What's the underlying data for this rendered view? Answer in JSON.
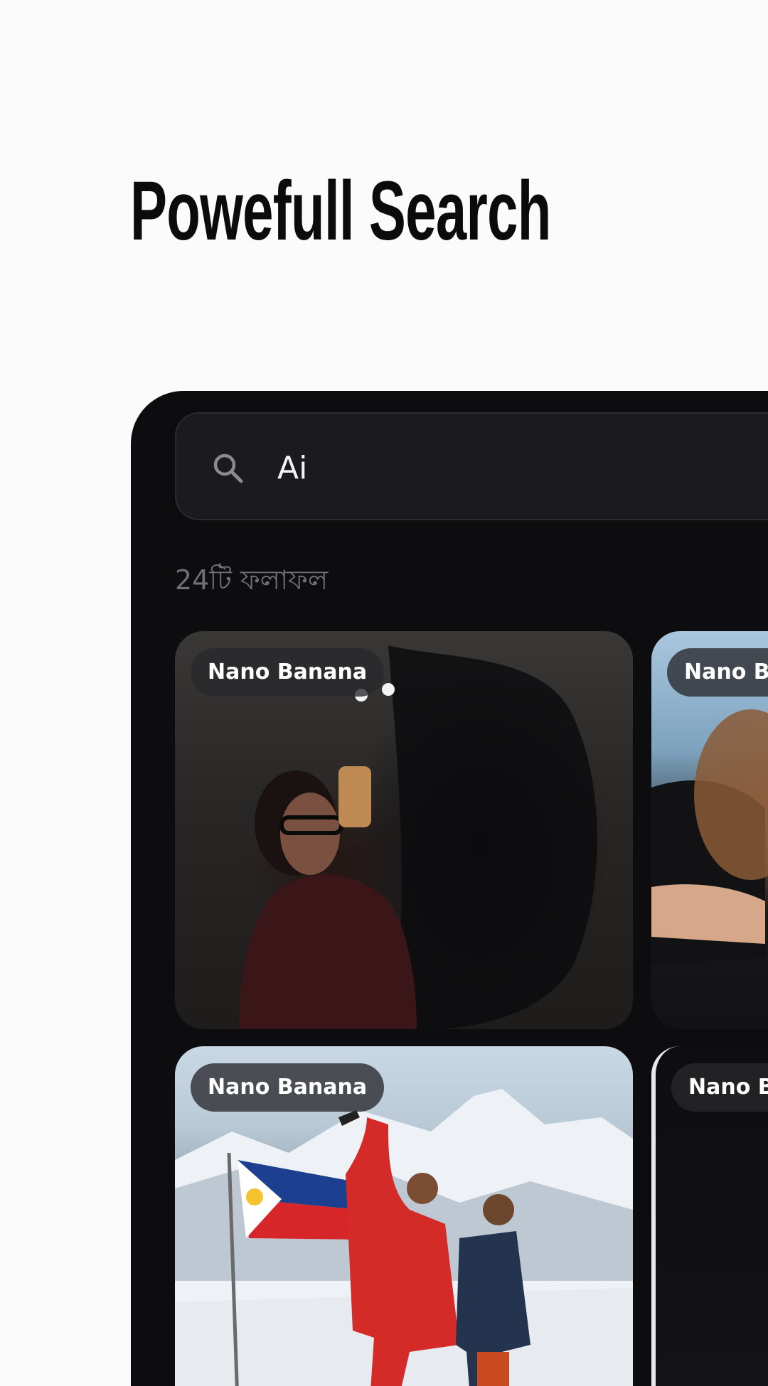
{
  "headline": "Powefull Search",
  "search": {
    "value": "Ai",
    "icon": "search-icon"
  },
  "results_count": "24টি ফলাফল",
  "colors": {
    "page_background": "#fbfbfb",
    "app_background": "#0d0d10",
    "search_background": "#1b1b1f",
    "badge_background": "#28282c",
    "headline_text": "#0b0b0c"
  },
  "results": [
    {
      "badge": "Nano Banana"
    },
    {
      "badge": "Nano Banana"
    },
    {
      "badge": "Nano Banana"
    },
    {
      "badge": "Nano Banana"
    }
  ]
}
